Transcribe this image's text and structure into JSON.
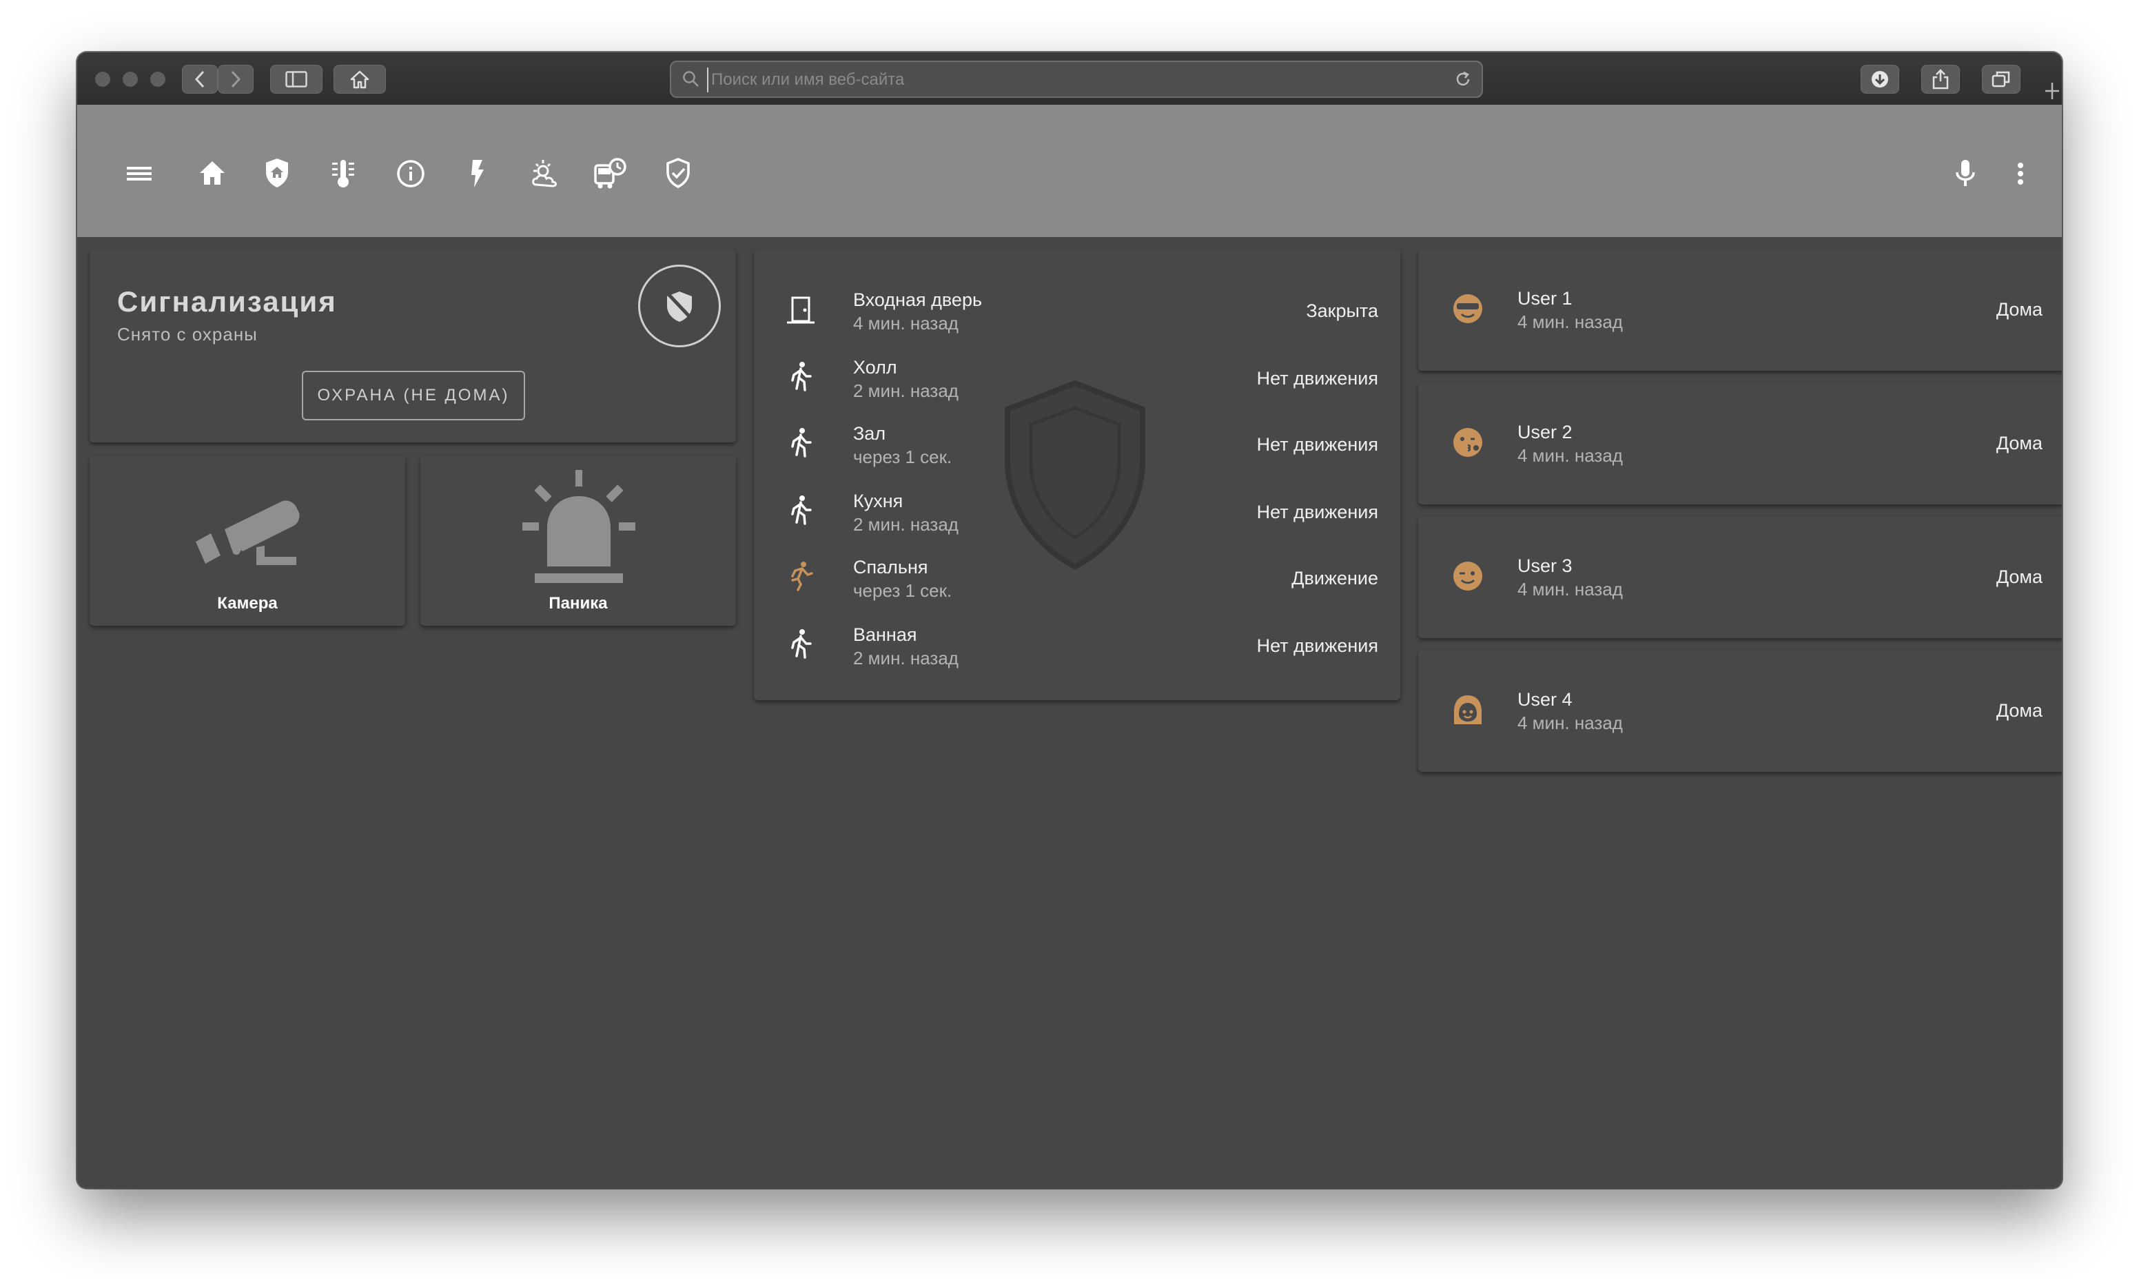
{
  "browser": {
    "url_placeholder": "Поиск или имя веб-сайта",
    "toolbar_icons": [
      "back-icon",
      "forward-icon",
      "sidebar-icon",
      "home-icon",
      "download-icon",
      "share-icon",
      "tabs-icon",
      "new-tab-icon"
    ]
  },
  "app": {
    "toolbar_icons": [
      "menu-icon",
      "home-icon",
      "security-icon",
      "climate-icon",
      "info-icon",
      "energy-icon",
      "weather-icon",
      "transport-icon",
      "shield-check-icon",
      "microphone-icon",
      "more-vert-icon"
    ],
    "active_tab": "security-icon",
    "colors": {
      "toolbar_bg": "#8a8a8a",
      "page_bg": "#464646",
      "card_bg": "#484848",
      "accent": "#c8935a"
    }
  },
  "alarm": {
    "title": "Сигнализация",
    "status": "Снято с охраны",
    "arm_button": "ОХРАНА (НЕ ДОМА)",
    "badge_icon": "shield-off-icon"
  },
  "tiles": [
    {
      "label": "Камера",
      "icon": "cctv-icon"
    },
    {
      "label": "Паника",
      "icon": "alarm-light-icon"
    }
  ],
  "sensors": [
    {
      "name": "Входная дверь",
      "time": "4 мин. назад",
      "state": "Закрыта",
      "icon": "door-closed-icon",
      "active": false
    },
    {
      "name": "Холл",
      "time": "2 мин. назад",
      "state": "Нет движения",
      "icon": "walk-icon",
      "active": false
    },
    {
      "name": "Зал",
      "time": "через 1 сек.",
      "state": "Нет движения",
      "icon": "walk-icon",
      "active": false
    },
    {
      "name": "Кухня",
      "time": "2 мин. назад",
      "state": "Нет движения",
      "icon": "walk-icon",
      "active": false
    },
    {
      "name": "Спальня",
      "time": "через 1 сек.",
      "state": "Движение",
      "icon": "run-icon",
      "active": true
    },
    {
      "name": "Ванная",
      "time": "2 мин. назад",
      "state": "Нет движения",
      "icon": "walk-icon",
      "active": false
    }
  ],
  "users": [
    {
      "name": "User 1",
      "time": "4 мин. назад",
      "state": "Дома",
      "icon": "face-cool-icon"
    },
    {
      "name": "User 2",
      "time": "4 мин. назад",
      "state": "Дома",
      "icon": "face-kiss-icon"
    },
    {
      "name": "User 3",
      "time": "4 мин. назад",
      "state": "Дома",
      "icon": "face-wink-icon"
    },
    {
      "name": "User 4",
      "time": "4 мин. назад",
      "state": "Дома",
      "icon": "face-woman-icon"
    }
  ]
}
